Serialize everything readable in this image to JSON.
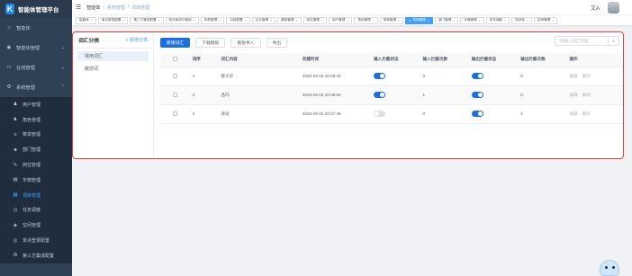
{
  "app": {
    "title": "智能体管理平台",
    "logo_letter": "K"
  },
  "sidebar": {
    "items": [
      {
        "label": "智能体",
        "icon": "dashboard-icon",
        "glyph": "⌂"
      },
      {
        "label": "智能体管理",
        "icon": "robot-icon",
        "glyph": "◉",
        "chevron": "⌄"
      },
      {
        "label": "在线管理",
        "icon": "monitor-icon",
        "glyph": "▭",
        "chevron": "⌄"
      },
      {
        "label": "系统管理",
        "icon": "gear-icon",
        "glyph": "⚙",
        "chevron": "⌃"
      }
    ],
    "sub_items": [
      {
        "label": "用户管理",
        "icon": "user-icon",
        "glyph": "♟"
      },
      {
        "label": "角色管理",
        "icon": "role-icon",
        "glyph": "♞"
      },
      {
        "label": "菜单管理",
        "icon": "menu-icon",
        "glyph": "≡"
      },
      {
        "label": "部门管理",
        "icon": "department-icon",
        "glyph": "♣"
      },
      {
        "label": "岗位管理",
        "icon": "post-icon",
        "glyph": "✎"
      },
      {
        "label": "字典管理",
        "icon": "dictionary-icon",
        "glyph": "▤"
      },
      {
        "label": "词库管理",
        "icon": "lexicon-icon",
        "glyph": "▦",
        "active": true
      },
      {
        "label": "任务调度",
        "icon": "schedule-icon",
        "glyph": "◷"
      },
      {
        "label": "空间管理",
        "icon": "space-icon",
        "glyph": "◈"
      },
      {
        "label": "单点登录配置",
        "icon": "sso-icon",
        "glyph": "◎"
      },
      {
        "label": "第三方集成配置",
        "icon": "integration-icon",
        "glyph": "⚙"
      }
    ]
  },
  "topbar": {
    "hamburger": "☰",
    "breadcrumb": [
      "智能体",
      "系统管理",
      "词库管理"
    ],
    "separator": "/",
    "translate_glyph": "文A"
  },
  "tags": [
    {
      "label": "智能体"
    },
    {
      "label": "单点登录配置"
    },
    {
      "label": "第三方集成配置"
    },
    {
      "label": "知识库访问授权"
    },
    {
      "label": "标签管理"
    },
    {
      "label": "对接配置"
    },
    {
      "label": "企业管理"
    },
    {
      "label": "模型管理"
    },
    {
      "label": "岗位管理"
    },
    {
      "label": "用户管理"
    },
    {
      "label": "角色管理"
    },
    {
      "label": "菜单管理"
    },
    {
      "label": "词库管理",
      "active": true
    },
    {
      "label": "部门管理"
    },
    {
      "label": "字典管理"
    },
    {
      "label": "任务调度"
    },
    {
      "label": "知识库"
    },
    {
      "label": "空间管理"
    }
  ],
  "categories": {
    "title": "词汇分类",
    "add_label": "+ 新增分类",
    "items": [
      {
        "label": "常用词汇",
        "active": true
      },
      {
        "label": "敏感词"
      }
    ]
  },
  "toolbar": {
    "add": "新增词汇",
    "download": "下载模板",
    "import": "模板导入",
    "export": "导出",
    "search_placeholder": "请输入词汇内容",
    "search_glyph": "⌕"
  },
  "table": {
    "headers": [
      "",
      "排序",
      "词汇内容",
      "创建时间",
      "输入拦截状态",
      "输入拦截次数",
      "输出拦截状态",
      "输出拦截次数",
      "操作"
    ],
    "rows": [
      {
        "order": "1",
        "word": "蓉大华",
        "created": "2025-09-15 20:08:44",
        "in_on": true,
        "in_count": "0",
        "out_on": true,
        "out_count": "0"
      },
      {
        "order": "2",
        "word": "品玛",
        "created": "2025-09-15 20:08:59",
        "in_on": true,
        "in_count": "1",
        "out_on": true,
        "out_count": "0"
      },
      {
        "order": "3",
        "word": "测试",
        "created": "2025-09-15 20:17:46",
        "in_on": false,
        "in_count": "0",
        "out_on": true,
        "out_count": "4"
      }
    ],
    "actions": [
      "编辑",
      "删除"
    ]
  }
}
